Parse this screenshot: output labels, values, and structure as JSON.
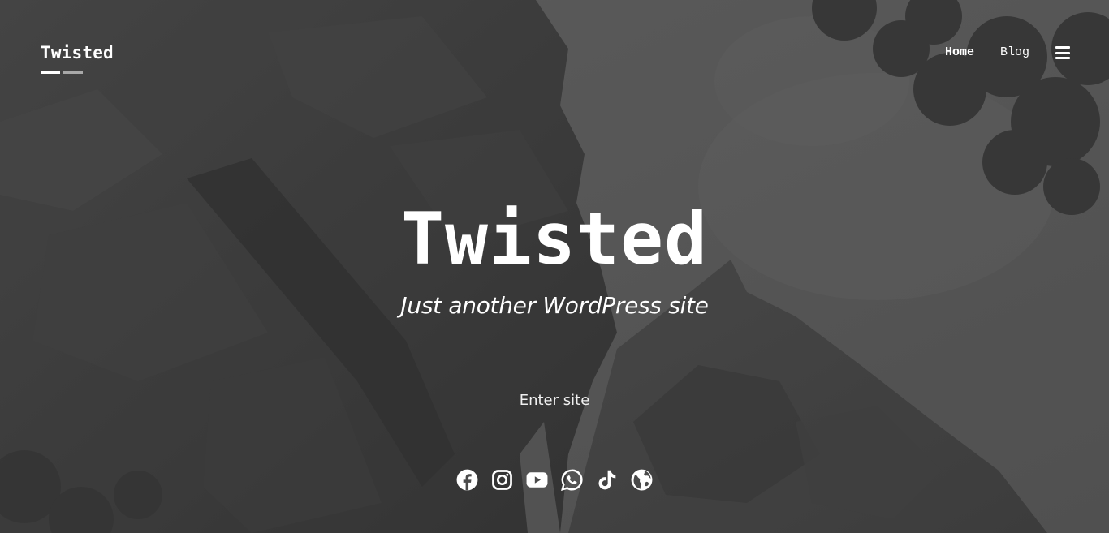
{
  "site": {
    "brand_name": "Twisted",
    "title": "Twisted",
    "tagline": "Just another WordPress site",
    "enter_label": "Enter site"
  },
  "nav": {
    "items": [
      {
        "label": "Home",
        "current": true
      },
      {
        "label": "Blog",
        "current": false
      }
    ],
    "menu_icon": "hamburger-icon"
  },
  "social": [
    {
      "name": "facebook-icon"
    },
    {
      "name": "instagram-icon"
    },
    {
      "name": "youtube-icon"
    },
    {
      "name": "whatsapp-icon"
    },
    {
      "name": "tiktok-icon"
    },
    {
      "name": "globe-icon"
    }
  ],
  "colors": {
    "text": "#ffffff",
    "brand_bar_primary": "#ffffff",
    "brand_bar_secondary": "#a8a8a8",
    "background": "#4a4a4a"
  }
}
